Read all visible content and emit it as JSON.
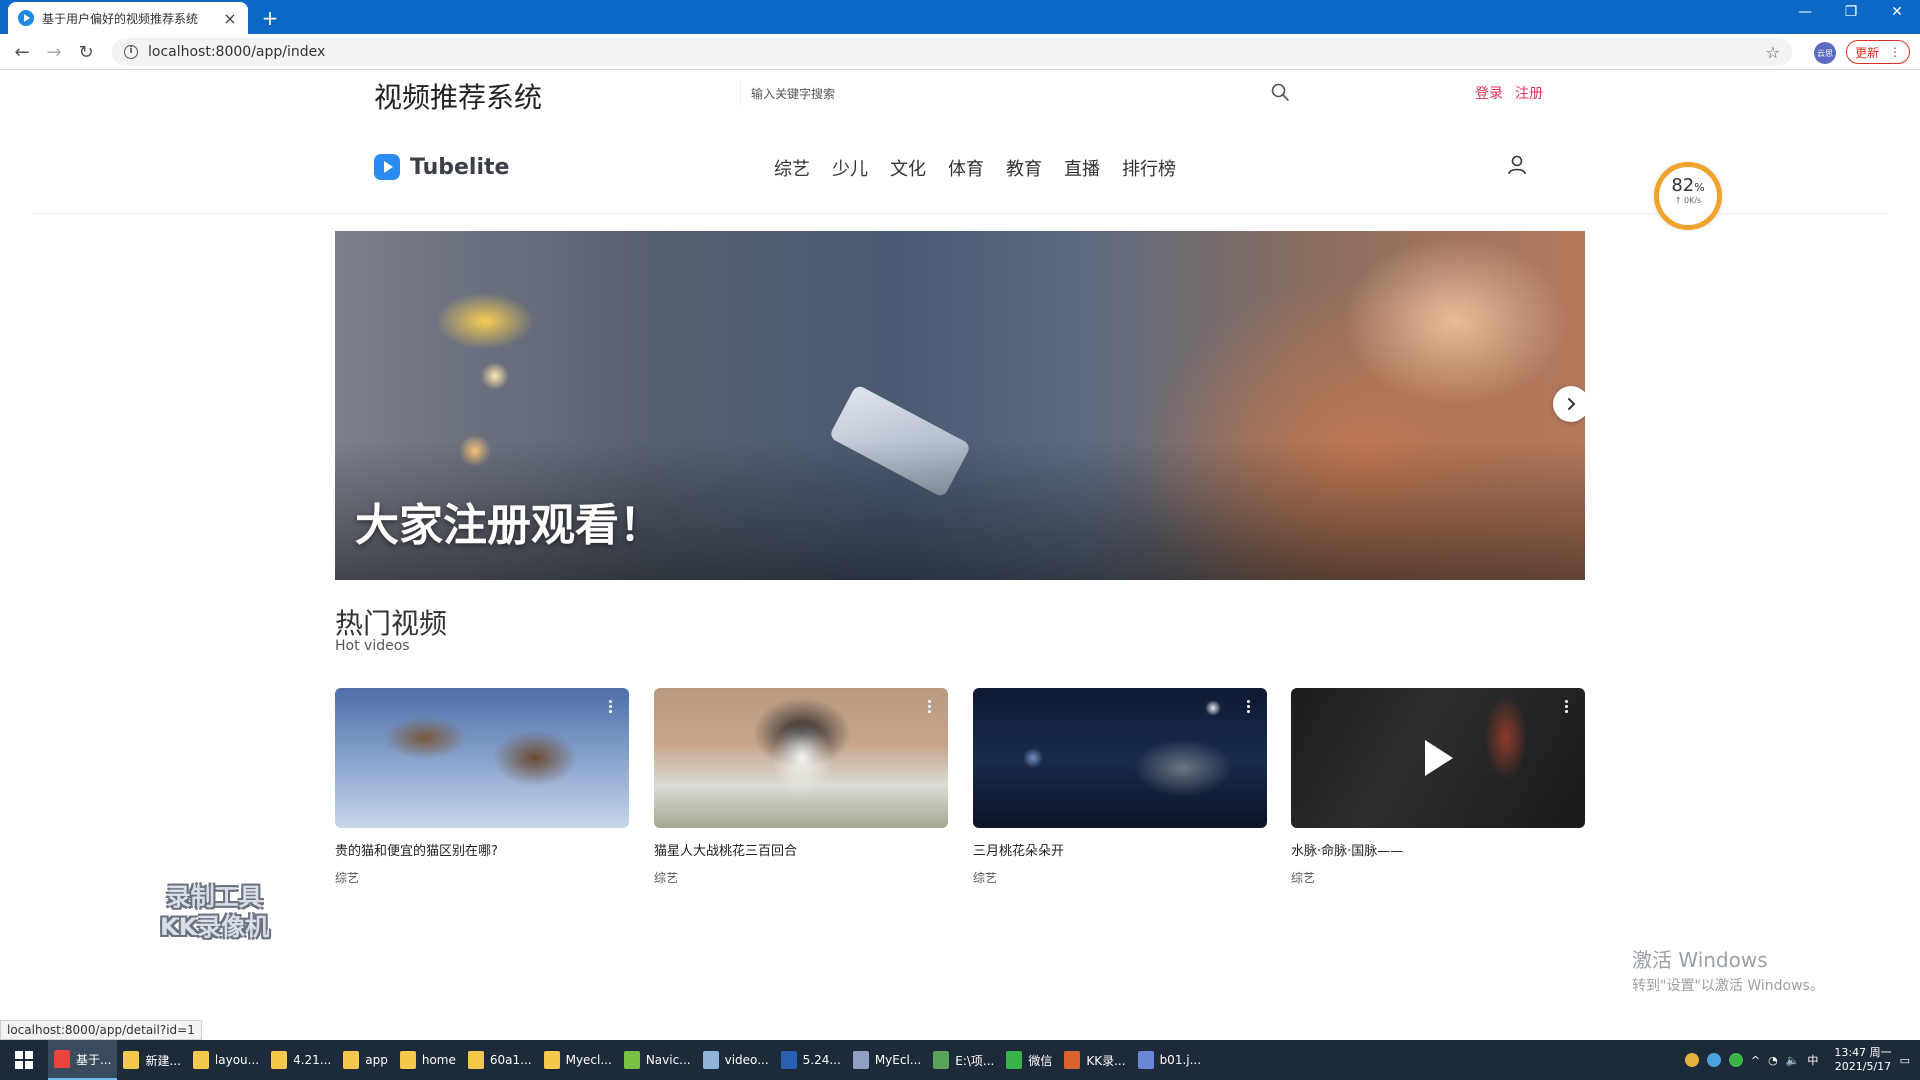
{
  "browser": {
    "tab_title": "基于用户偏好的视频推荐系统",
    "tab_close": "×",
    "new_tab": "+",
    "url": "localhost:8000/app/index",
    "profile_label": "云思",
    "update_label": "更新",
    "status_url": "localhost:8000/app/detail?id=1"
  },
  "site": {
    "title": "视频推荐系统",
    "search_placeholder": "输入关键字搜索",
    "login": "登录",
    "register": "注册",
    "logo_text": "Tubelite",
    "nav": [
      "综艺",
      "少儿",
      "文化",
      "体育",
      "教育",
      "直播",
      "排行榜"
    ],
    "accent_color": "#e0325a",
    "logo_color": "#2a8bf2"
  },
  "speed_widget": {
    "percent": "82",
    "percent_sign": "%",
    "rate": "↑ 0K/s"
  },
  "banner": {
    "title": "大家注册观看！"
  },
  "hot": {
    "title": "热门视频",
    "subtitle": "Hot videos",
    "videos": [
      {
        "title": "贵的猫和便宜的猫区别在哪?",
        "tag": "综艺",
        "thumb_icon": "birds-thumbnail"
      },
      {
        "title": "猫星人大战桃花三百回合",
        "tag": "综艺",
        "thumb_icon": "dog-thumbnail"
      },
      {
        "title": "三月桃花朵朵开",
        "tag": "综艺",
        "thumb_icon": "car-thumbnail"
      },
      {
        "title": "水脉·命脉·国脉——",
        "tag": "综艺",
        "thumb_icon": "play-thumbnail"
      }
    ]
  },
  "overlays": {
    "watermark_line1": "录制工具",
    "watermark_line2": "KK录像机",
    "activate_line1": "激活 Windows",
    "activate_line2": "转到\"设置\"以激活 Windows。"
  },
  "taskbar": {
    "items": [
      {
        "label": "基于...",
        "color": "#e8453c"
      },
      {
        "label": "新建...",
        "color": "#f2c94c"
      },
      {
        "label": "layou...",
        "color": "#f2c94c"
      },
      {
        "label": "4.21...",
        "color": "#f2c94c"
      },
      {
        "label": "app",
        "color": "#f2c94c"
      },
      {
        "label": "home",
        "color": "#f2c94c"
      },
      {
        "label": "60a1...",
        "color": "#f2c94c"
      },
      {
        "label": "Myecl...",
        "color": "#f2c94c"
      },
      {
        "label": "Navic...",
        "color": "#7cc242"
      },
      {
        "label": "video...",
        "color": "#8fb3d9"
      },
      {
        "label": "5.24...",
        "color": "#2b5fb4"
      },
      {
        "label": "MyEcl...",
        "color": "#8fa0c0"
      },
      {
        "label": "E:\\项...",
        "color": "#5aa35a"
      },
      {
        "label": "微信",
        "color": "#3cb34a"
      },
      {
        "label": "KK录...",
        "color": "#d9622b"
      },
      {
        "label": "b01.j...",
        "color": "#6a86d6"
      }
    ],
    "ime": "中",
    "time": "13:47 周一",
    "date": "2021/5/17"
  }
}
